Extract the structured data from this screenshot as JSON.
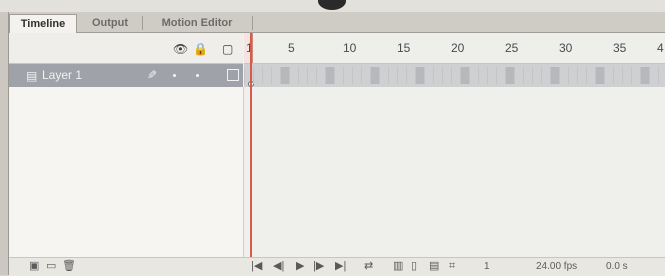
{
  "tabs": [
    "Timeline",
    "Output",
    "Motion Editor"
  ],
  "header_icons": [
    "eye-icon",
    "lock-icon",
    "outline-icon"
  ],
  "layer": {
    "name": "Layer 1",
    "icon": "layer-icon",
    "edit_icon": "pencil-icon"
  },
  "ruler": {
    "frame_label": "1",
    "ticks": [
      "5",
      "10",
      "15",
      "20",
      "25",
      "30",
      "35",
      "4"
    ]
  },
  "bottom": {
    "left_icons": [
      "new-layer-icon",
      "new-folder-icon",
      "delete-icon"
    ],
    "transport_icons": [
      "first-frame-icon",
      "step-back-icon",
      "play-icon",
      "step-forward-icon",
      "last-frame-icon"
    ],
    "frame": "1",
    "fps": "24.00 fps",
    "time": "0.0 s"
  }
}
